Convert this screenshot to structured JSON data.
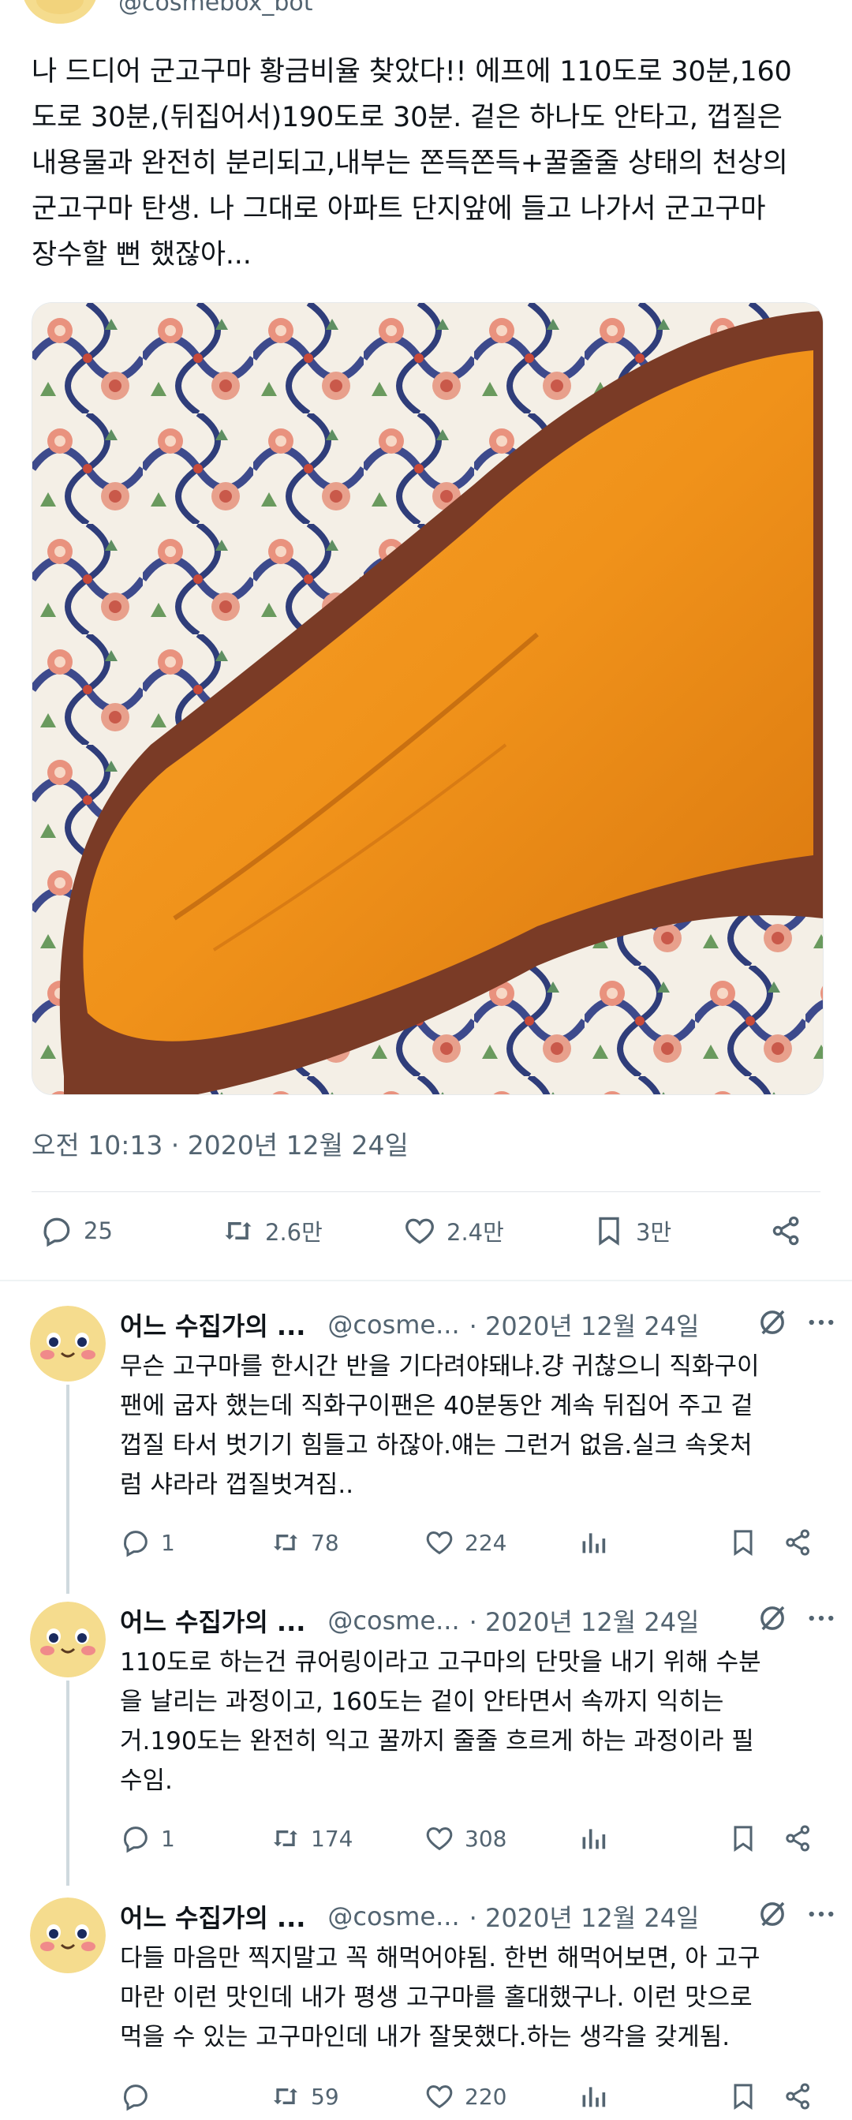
{
  "tweet": {
    "handle": "@cosmebox_bot",
    "text_lines": [
      "나 드디어 군고구마 황금비율 찾았다!! 에프에 110도로 30분,160",
      "도로 30분,(뒤집어서)190도로 30분. 겉은 하나도 안타고, 껍질은",
      "내용물과 완전히 분리되고,내부는 쫀득쫀득+꿀줄줄 상태의 천상의",
      "군고구마 탄생. 나 그대로 아파트 단지앞에 들고 나가서 군고구마",
      "장수할 뻔 했잖아..."
    ],
    "timestamp": "오전 10:13 · 2020년 12월 24일",
    "stats": {
      "replies": "25",
      "retweets": "2.6만",
      "likes": "2.4만",
      "bookmarks": "3만"
    }
  },
  "replies": [
    {
      "name": "어느 수집가의 ...",
      "handle": "@cosme...",
      "date": "· 2020년 12월 24일",
      "lines": [
        "무슨 고구마를 한시간 반을 기다려야돼냐.걍 귀찮으니 직화구이",
        "팬에 굽자 했는데 직화구이팬은 40분동안 계속 뒤집어 주고 겉",
        "껍질 타서 벗기기 힘들고 하잖아.얘는 그런거 없음.실크 속옷처",
        "럼 샤라라 껍질벗겨짐.."
      ],
      "reply_count": "1",
      "retweet_count": "78",
      "like_count": "224"
    },
    {
      "name": "어느 수집가의 ...",
      "handle": "@cosme...",
      "date": "· 2020년 12월 24일",
      "lines": [
        "110도로 하는건 큐어링이라고 고구마의 단맛을 내기 위해 수분",
        "을 날리는 과정이고, 160도는 겉이 안타면서 속까지 익히는",
        "거.190도는 완전히 익고 꿀까지 줄줄 흐르게 하는 과정이라 필",
        "수임."
      ],
      "reply_count": "1",
      "retweet_count": "174",
      "like_count": "308"
    },
    {
      "name": "어느 수집가의 ...",
      "handle": "@cosme...",
      "date": "· 2020년 12월 24일",
      "lines": [
        "다들 마음만 찍지말고 꼭 해먹어야됨. 한번 해먹어보면, 아 고구",
        "마란 이런 맛인데 내가 평생 고구마를 홀대했구나. 이런 맛으로",
        "먹을 수 있는 고구마인데 내가 잘못했다.하는 생각을 갖게됨."
      ],
      "reply_count": "",
      "retweet_count": "59",
      "like_count": "220"
    }
  ],
  "colors": {
    "text": "#0f1419",
    "secondary": "#536471",
    "avatar": "#f5dc8e"
  }
}
